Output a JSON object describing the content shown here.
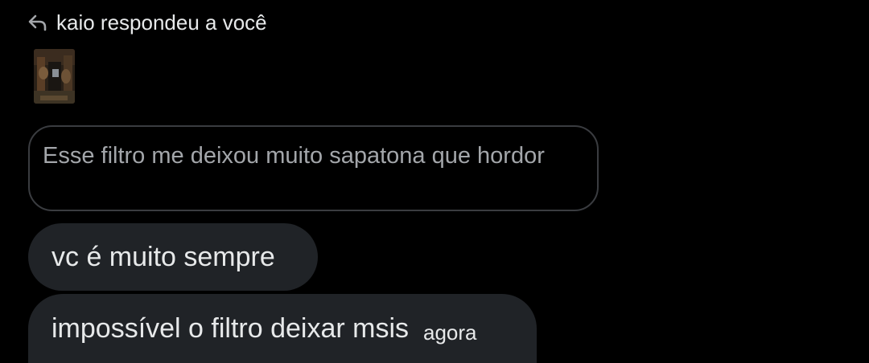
{
  "reply_header": {
    "text": "kaio respondeu a você",
    "icon": "reply-arrow-icon"
  },
  "story_thumbnail": {
    "description_icon": "story-thumbnail-image"
  },
  "quoted_message": {
    "text": "Esse filtro me deixou muito sapatona que hordor"
  },
  "messages": [
    {
      "text": "vc é muito sempre"
    },
    {
      "text": "impossível o filtro deixar msis",
      "time": "agora"
    }
  ],
  "colors": {
    "background": "#000000",
    "bubble": "#202327",
    "text": "#e7e9ea",
    "quoted_text": "#a3a6aa",
    "quoted_border": "#3a3c40"
  }
}
